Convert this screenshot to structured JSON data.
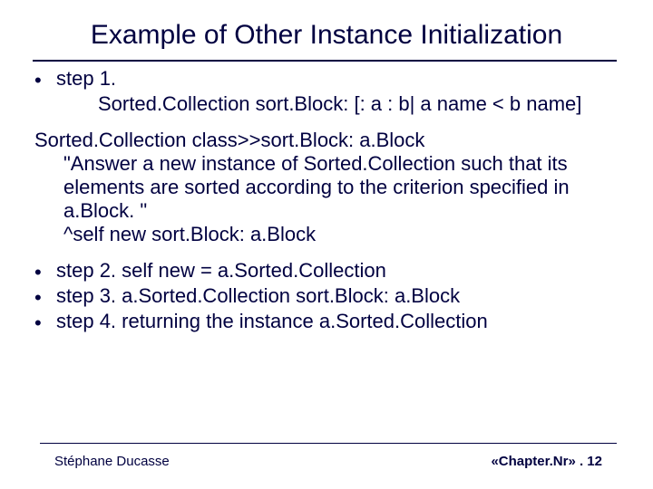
{
  "title": "Example of Other Instance Initialization",
  "step1": {
    "label": "step 1.",
    "code": "Sorted.Collection sort.Block: [: a : b| a name < b name]"
  },
  "method": {
    "line1": "Sorted.Collection class>>sort.Block: a.Block",
    "line2": "\"Answer a new instance of Sorted.Collection such that its elements are sorted according to the criterion specified in a.Block. \"",
    "line3": "^self new sort.Block: a.Block"
  },
  "steps": {
    "s2": "step 2. self new = a.Sorted.Collection",
    "s3": "step 3. a.Sorted.Collection sort.Block: a.Block",
    "s4": "step 4. returning the instance a.Sorted.Collection"
  },
  "footer": {
    "author": "Stéphane Ducasse",
    "pager": "«Chapter.Nr» . 12"
  }
}
